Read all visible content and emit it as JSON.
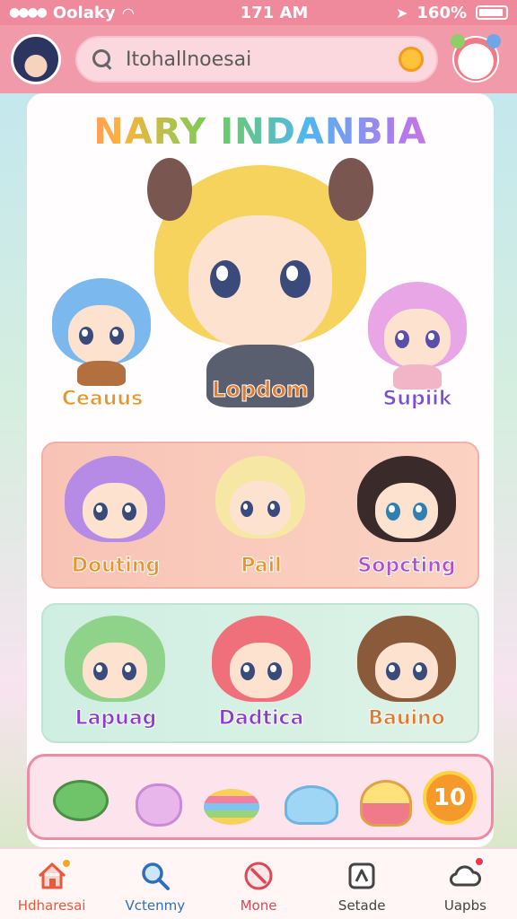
{
  "status_bar": {
    "carrier": "Oolaky",
    "time": "171 AM",
    "battery": "160%"
  },
  "header": {
    "search_placeholder": "Itohallnoesai"
  },
  "main": {
    "title": "NARY INDANBIA",
    "featured": [
      {
        "name": "Ceauus",
        "color": "#e8952a"
      },
      {
        "name": "Lopdom",
        "color": "#e07a2e"
      },
      {
        "name": "Supiik",
        "color": "#7a4fd0"
      }
    ],
    "row1": [
      {
        "name": "Douting",
        "color": "#e8952a"
      },
      {
        "name": "Pail",
        "color": "#e8952a"
      },
      {
        "name": "Sopcting",
        "color": "#b24fd0"
      }
    ],
    "row2": [
      {
        "name": "Lapuag",
        "color": "#8a3fd0"
      },
      {
        "name": "Dadtica",
        "color": "#8a3fd0"
      },
      {
        "name": "Bauino",
        "color": "#e07a2e"
      }
    ]
  },
  "tray": {
    "stickers": [
      "frog-sticker",
      "bunny-sticker",
      "rainbow-cake-sticker",
      "blue-slime-sticker",
      "chick-sticker"
    ],
    "count": "10"
  },
  "nav": {
    "items": [
      {
        "label": "Hdharesai",
        "icon": "home-icon",
        "color": "#e8593c"
      },
      {
        "label": "Vctenmy",
        "icon": "search-icon",
        "color": "#2f6fb8"
      },
      {
        "label": "Mone",
        "icon": "compass-icon",
        "color": "#d94a57"
      },
      {
        "label": "Setade",
        "icon": "settings-icon",
        "color": "#444444"
      },
      {
        "label": "Uapbs",
        "icon": "cloud-icon",
        "color": "#444444"
      }
    ]
  },
  "colors": {
    "accent": "#f19aaa",
    "status_bar": "#ee8a9c"
  }
}
